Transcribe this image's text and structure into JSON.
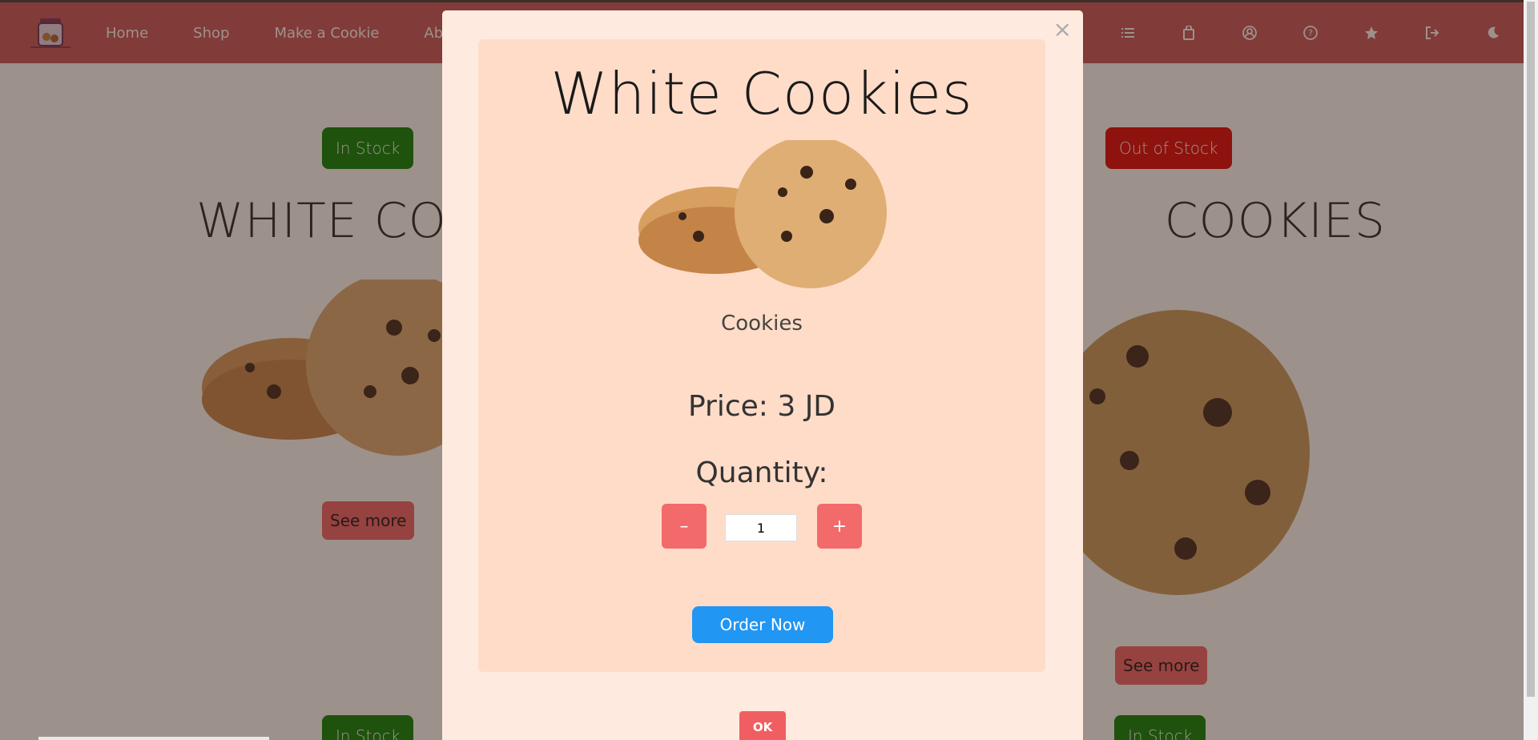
{
  "nav": {
    "links": [
      "Home",
      "Shop",
      "Make a Cookie",
      "About"
    ],
    "icons": [
      "list-icon",
      "shopping-bag-icon",
      "user-icon",
      "help-icon",
      "star-icon",
      "logout-icon",
      "dark-mode-icon"
    ]
  },
  "products": [
    {
      "stock": "In Stock",
      "title": "WHITE COOKIES",
      "see_more": "See more"
    },
    {
      "stock": "Out of Stock",
      "title": "COOKIES",
      "see_more": "See more"
    }
  ],
  "bottom_badges": [
    "In Stock",
    "In Stock"
  ],
  "modal": {
    "close": "×",
    "title": "White Cookies",
    "category": "Cookies",
    "price": "Price: 3 JD",
    "quantity_label": "Quantity:",
    "minus": "–",
    "plus": "+",
    "quantity_value": "1",
    "order_label": "Order Now",
    "ok_label": "OK"
  },
  "colors": {
    "navbar": "#c75356",
    "in_stock": "#008000",
    "out_of_stock": "#e00000",
    "see_more": "#f06066",
    "modal_bg": "#ffeae0",
    "modal_inner": "#ffdcc8",
    "order_button": "#2196f3",
    "qty_button": "#f36a6a"
  }
}
